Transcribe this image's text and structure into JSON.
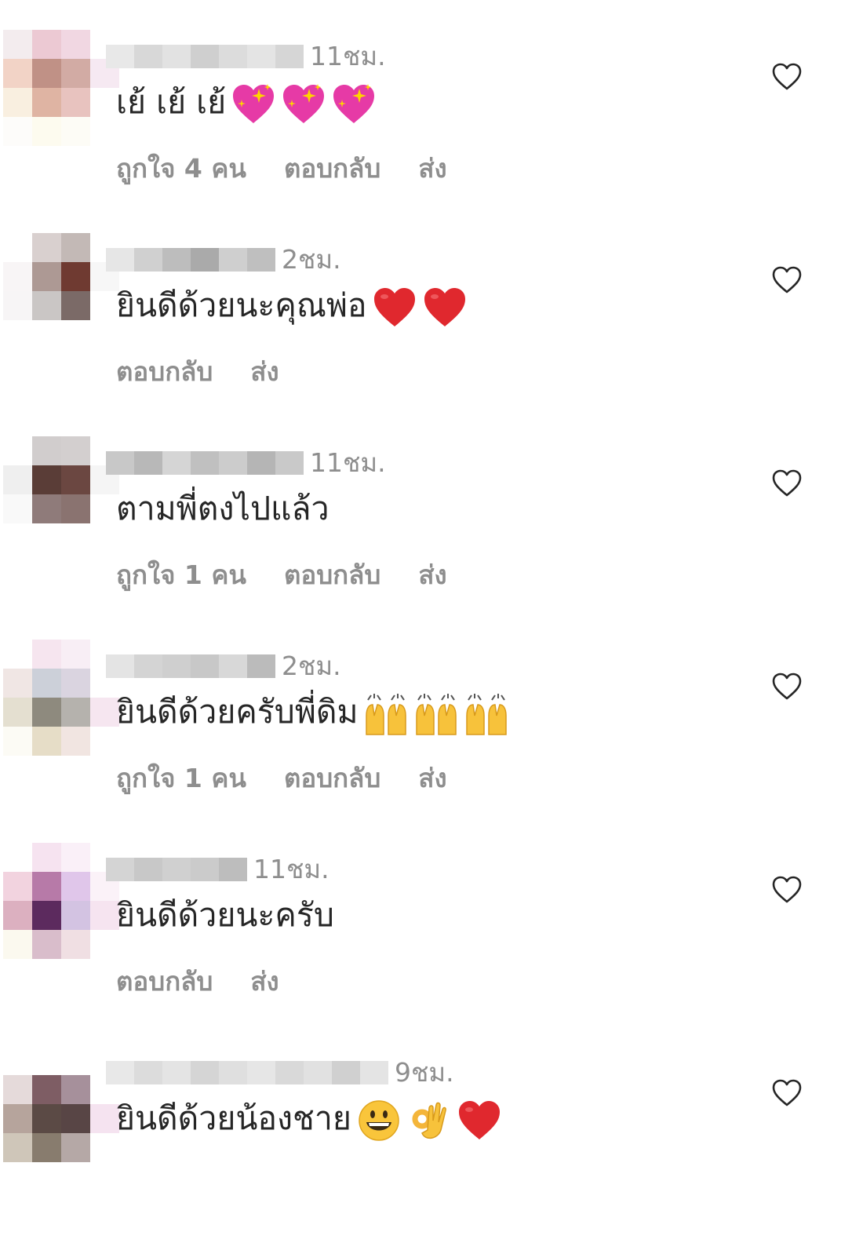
{
  "comments": [
    {
      "time": "11ชม.",
      "text": "เย้ เย้ เย้",
      "emojis": [
        "sparkling-heart",
        "sparkling-heart",
        "sparkling-heart"
      ],
      "likes": "ถูกใจ 4 คน",
      "reply": "ตอบกลับ",
      "send": "ส่ง",
      "avatar_colors": [
        "#f3ecee",
        "#ecc9d3",
        "#f1d7e2",
        "#ffffff",
        "#f2d3c6",
        "#c09186",
        "#d2aba4",
        "#f6e9f2",
        "#f9efe0",
        "#dfb4a3",
        "#e8c3bf",
        "#ffffff",
        "#fdfcfa",
        "#fdfbef",
        "#fdfcf6",
        "#ffffff"
      ],
      "username_blur": [
        "#e8e8e8",
        "#d8d8d8",
        "#e2e2e2",
        "#cfcfcf",
        "#dcdcdc",
        "#e4e4e4",
        "#d6d6d6"
      ]
    },
    {
      "time": "2ชม.",
      "text": "ยินดีด้วยนะคุณพ่อ",
      "emojis": [
        "red-heart",
        "red-heart"
      ],
      "likes": "",
      "reply": "ตอบกลับ",
      "send": "ส่ง",
      "avatar_colors": [
        "#ffffff",
        "#d9d0cf",
        "#c3b9b6",
        "#ffffff",
        "#f8f5f6",
        "#ad9994",
        "#6f3a31",
        "#f7f7f7",
        "#f7f5f6",
        "#cac6c5",
        "#7b6a67",
        "#ffffff",
        "#ffffff",
        "#ffffff",
        "#ffffff",
        "#ffffff"
      ],
      "username_blur": [
        "#e6e6e6",
        "#d0d0d0",
        "#bdbdbd",
        "#aaaaaa",
        "#cfcfcf",
        "#bfbfbf"
      ]
    },
    {
      "time": "11ชม.",
      "text": "ตามพี่ตงไปแล้ว",
      "emojis": [],
      "likes": "ถูกใจ 1 คน",
      "reply": "ตอบกลับ",
      "send": "ส่ง",
      "avatar_colors": [
        "#ffffff",
        "#d1cdcd",
        "#d3cfcf",
        "#ffffff",
        "#efefef",
        "#5a3d37",
        "#6b4741",
        "#f5f5f5",
        "#f9f9f9",
        "#8f7b7a",
        "#8a7370",
        "#ffffff",
        "#ffffff",
        "#ffffff",
        "#ffffff",
        "#ffffff"
      ],
      "username_blur": [
        "#c8c8c8",
        "#b8b8b8",
        "#d5d5d5",
        "#c0c0c0",
        "#cccccc",
        "#b5b5b5",
        "#c9c9c9"
      ]
    },
    {
      "time": "2ชม.",
      "text": "ยินดีด้วยครับพี่ดิม",
      "emojis": [
        "raising-hands",
        "raising-hands",
        "raising-hands"
      ],
      "likes": "ถูกใจ 1 คน",
      "reply": "ตอบกลับ",
      "send": "ส่ง",
      "avatar_colors": [
        "#ffffff",
        "#f6e5ef",
        "#f8eef5",
        "#ffffff",
        "#f0e6e4",
        "#ccd0d9",
        "#dad4e0",
        "#ffffff",
        "#e4dfd0",
        "#8e8a7e",
        "#b5b2ad",
        "#f6e6f0",
        "#fcfbf5",
        "#e6ddc7",
        "#f1e5e1",
        "#ffffff"
      ],
      "username_blur": [
        "#e4e4e4",
        "#d4d4d4",
        "#cfcfcf",
        "#c8c8c8",
        "#d8d8d8",
        "#bbbbbb"
      ]
    },
    {
      "time": "11ชม.",
      "text": "ยินดีด้วยนะครับ",
      "emojis": [],
      "likes": "",
      "reply": "ตอบกลับ",
      "send": "ส่ง",
      "avatar_colors": [
        "#ffffff",
        "#f6e3f0",
        "#faf0f8",
        "#ffffff",
        "#f2d3df",
        "#b77aa8",
        "#e0c6ea",
        "#fbf2f8",
        "#dcb0c0",
        "#5c2a5e",
        "#d3c3e2",
        "#f6e4f0",
        "#fbf9ef",
        "#d9bdcb",
        "#f0dfe3",
        "#ffffff"
      ],
      "username_blur": [
        "#d4d4d4",
        "#c8c8c8",
        "#d0d0d0",
        "#cbcbcb",
        "#bdbdbd"
      ]
    },
    {
      "time": "9ชม.",
      "text": "ยินดีด้วยน้องชาย",
      "emojis": [
        "grinning-face",
        "ok-hand",
        "red-heart"
      ],
      "likes": "",
      "reply": "",
      "send": "",
      "avatar_colors": [
        "#ffffff",
        "#ffffff",
        "#ffffff",
        "#ffffff",
        "#e5dada",
        "#7e5d64",
        "#a6909b",
        "#ffffff",
        "#b6a49c",
        "#5b4a45",
        "#584545",
        "#f5e3f0",
        "#cfc6b9",
        "#887c6e",
        "#b5a8a6",
        "#ffffff"
      ],
      "username_blur": [
        "#e8e8e8",
        "#dcdcdc",
        "#e4e4e4",
        "#d5d5d5",
        "#dfdfdf",
        "#e6e6e6",
        "#d9d9d9",
        "#e1e1e1",
        "#d0d0d0",
        "#e4e4e4"
      ]
    }
  ]
}
